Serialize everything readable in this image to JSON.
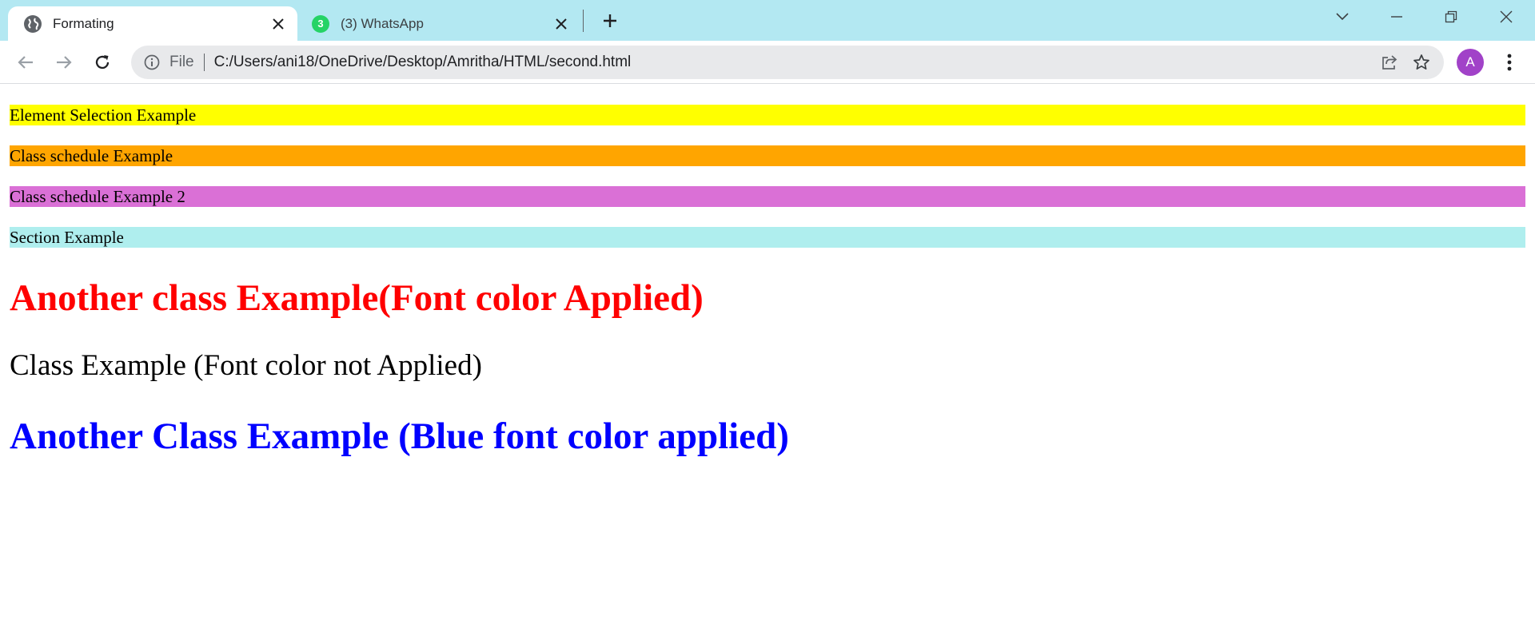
{
  "browser": {
    "tabs": [
      {
        "title": "Formating",
        "icon": "globe-icon",
        "active": true
      },
      {
        "title": "(3) WhatsApp",
        "icon": "whatsapp-icon",
        "badge": "3",
        "active": false
      }
    ],
    "address": {
      "scheme": "File",
      "url": "C:/Users/ani18/OneDrive/Desktop/Amritha/HTML/second.html"
    },
    "profile_initial": "A",
    "colors": {
      "tabstrip": "#b3e8f2",
      "profile": "#a142c8"
    }
  },
  "page": {
    "sections": [
      {
        "text": "Element Selection Example",
        "background": "#ffff00"
      },
      {
        "text": "Class schedule Example",
        "background": "#ffa500"
      },
      {
        "text": "Class schedule Example 2",
        "background": "#da70d6"
      },
      {
        "text": "Section Example",
        "background": "#afeeee"
      }
    ],
    "red_heading": {
      "text": "Another class Example(Font color Applied)",
      "color": "#ff0000"
    },
    "plain_heading": {
      "text": "Class Example (Font color not Applied)",
      "color": "#000000"
    },
    "blue_heading": {
      "text": "Another Class Example (Blue font color applied)",
      "color": "#0000ff"
    }
  }
}
